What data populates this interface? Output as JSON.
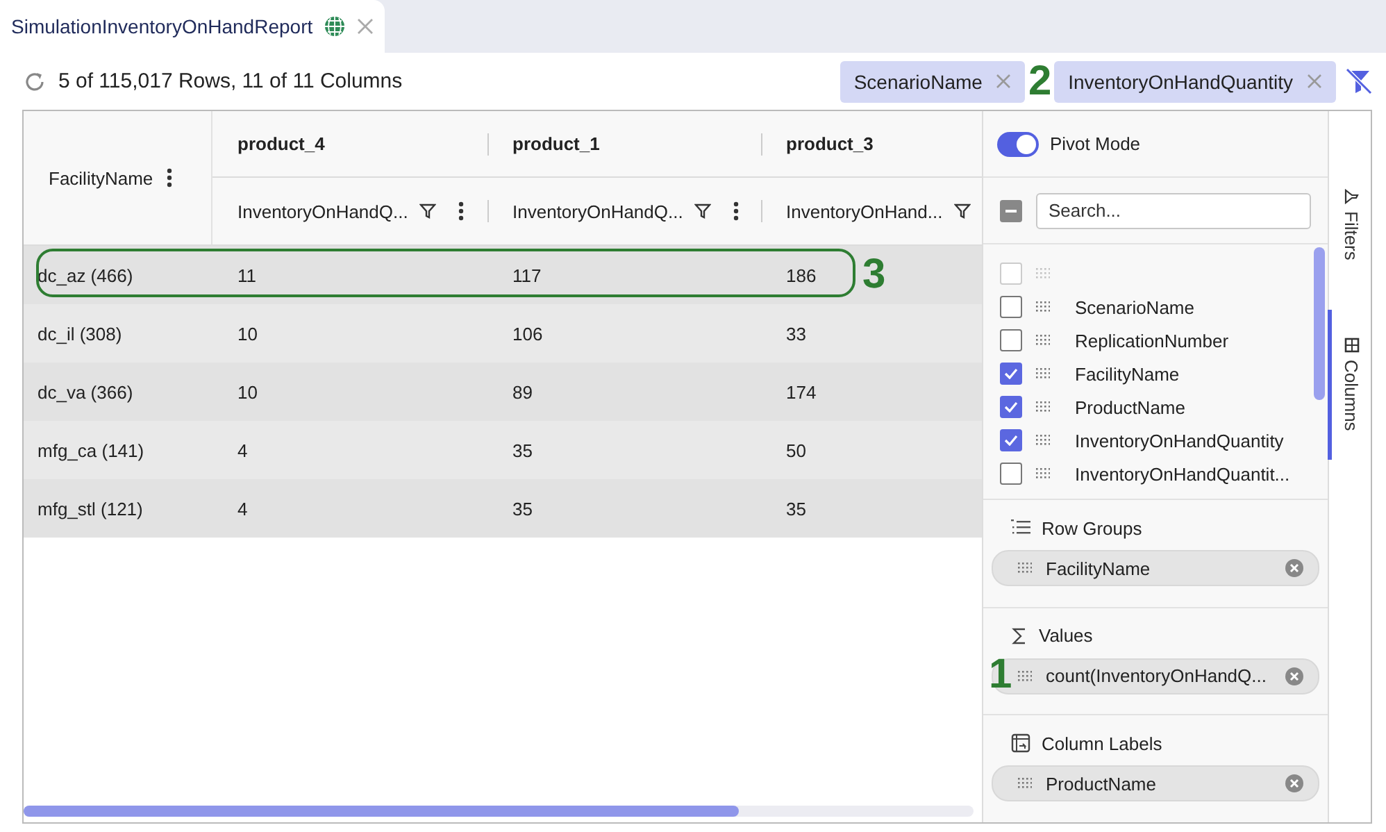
{
  "tab": {
    "title": "SimulationInventoryOnHandReport"
  },
  "toolbar": {
    "status": "5 of 115,017 Rows, 11 of 11 Columns",
    "filter_chips": [
      {
        "label": "ScenarioName"
      },
      {
        "label": "InventoryOnHandQuantity"
      }
    ]
  },
  "grid": {
    "row_group_header": "FacilityName",
    "pivot_columns": [
      {
        "group": "product_4",
        "value_header": "InventoryOnHandQ...",
        "menu": true
      },
      {
        "group": "product_1",
        "value_header": "InventoryOnHandQ...",
        "menu": true
      },
      {
        "group": "product_3",
        "value_header": "InventoryOnHand..."
      }
    ],
    "rows": [
      {
        "cells": [
          "dc_az (466)",
          "11",
          "117",
          "186"
        ]
      },
      {
        "cells": [
          "dc_il (308)",
          "10",
          "106",
          "33"
        ]
      },
      {
        "cells": [
          "dc_va (366)",
          "10",
          "89",
          "174"
        ]
      },
      {
        "cells": [
          "mfg_ca (141)",
          "4",
          "35",
          "50"
        ]
      },
      {
        "cells": [
          "mfg_stl (121)",
          "4",
          "35",
          "35"
        ]
      }
    ]
  },
  "side_panel": {
    "pivot_mode": {
      "label": "Pivot Mode",
      "on": true
    },
    "select_all_indeterminate": true,
    "search": {
      "placeholder": "Search..."
    },
    "columns": [
      {
        "checked": false,
        "disabled": true
      },
      {
        "label": "ScenarioName",
        "checked": false,
        "disabled": false
      },
      {
        "label": "ReplicationNumber",
        "checked": false,
        "disabled": false
      },
      {
        "label": "FacilityName",
        "checked": true,
        "disabled": false
      },
      {
        "label": "ProductName",
        "checked": true,
        "disabled": false
      },
      {
        "label": "InventoryOnHandQuantity",
        "checked": true,
        "disabled": false
      },
      {
        "label": "InventoryOnHandQuantit...",
        "checked": false,
        "disabled": false
      }
    ],
    "sections": [
      {
        "kind": "row_groups",
        "title": "Row Groups",
        "chips": [
          "FacilityName"
        ]
      },
      {
        "kind": "values",
        "title": "Values",
        "chips": [
          "count(InventoryOnHandQ..."
        ]
      },
      {
        "kind": "column_labels",
        "title": "Column Labels",
        "chips": [
          "ProductName"
        ]
      }
    ]
  },
  "side_tabs": [
    {
      "kind": "filters",
      "label": "Filters",
      "selected": false
    },
    {
      "kind": "columns",
      "label": "Columns",
      "selected": true
    }
  ],
  "annotations": [
    {
      "label": "1",
      "kind": "value"
    },
    {
      "label": "2",
      "kind": "chip"
    },
    {
      "label": "3",
      "kind": "row"
    }
  ]
}
